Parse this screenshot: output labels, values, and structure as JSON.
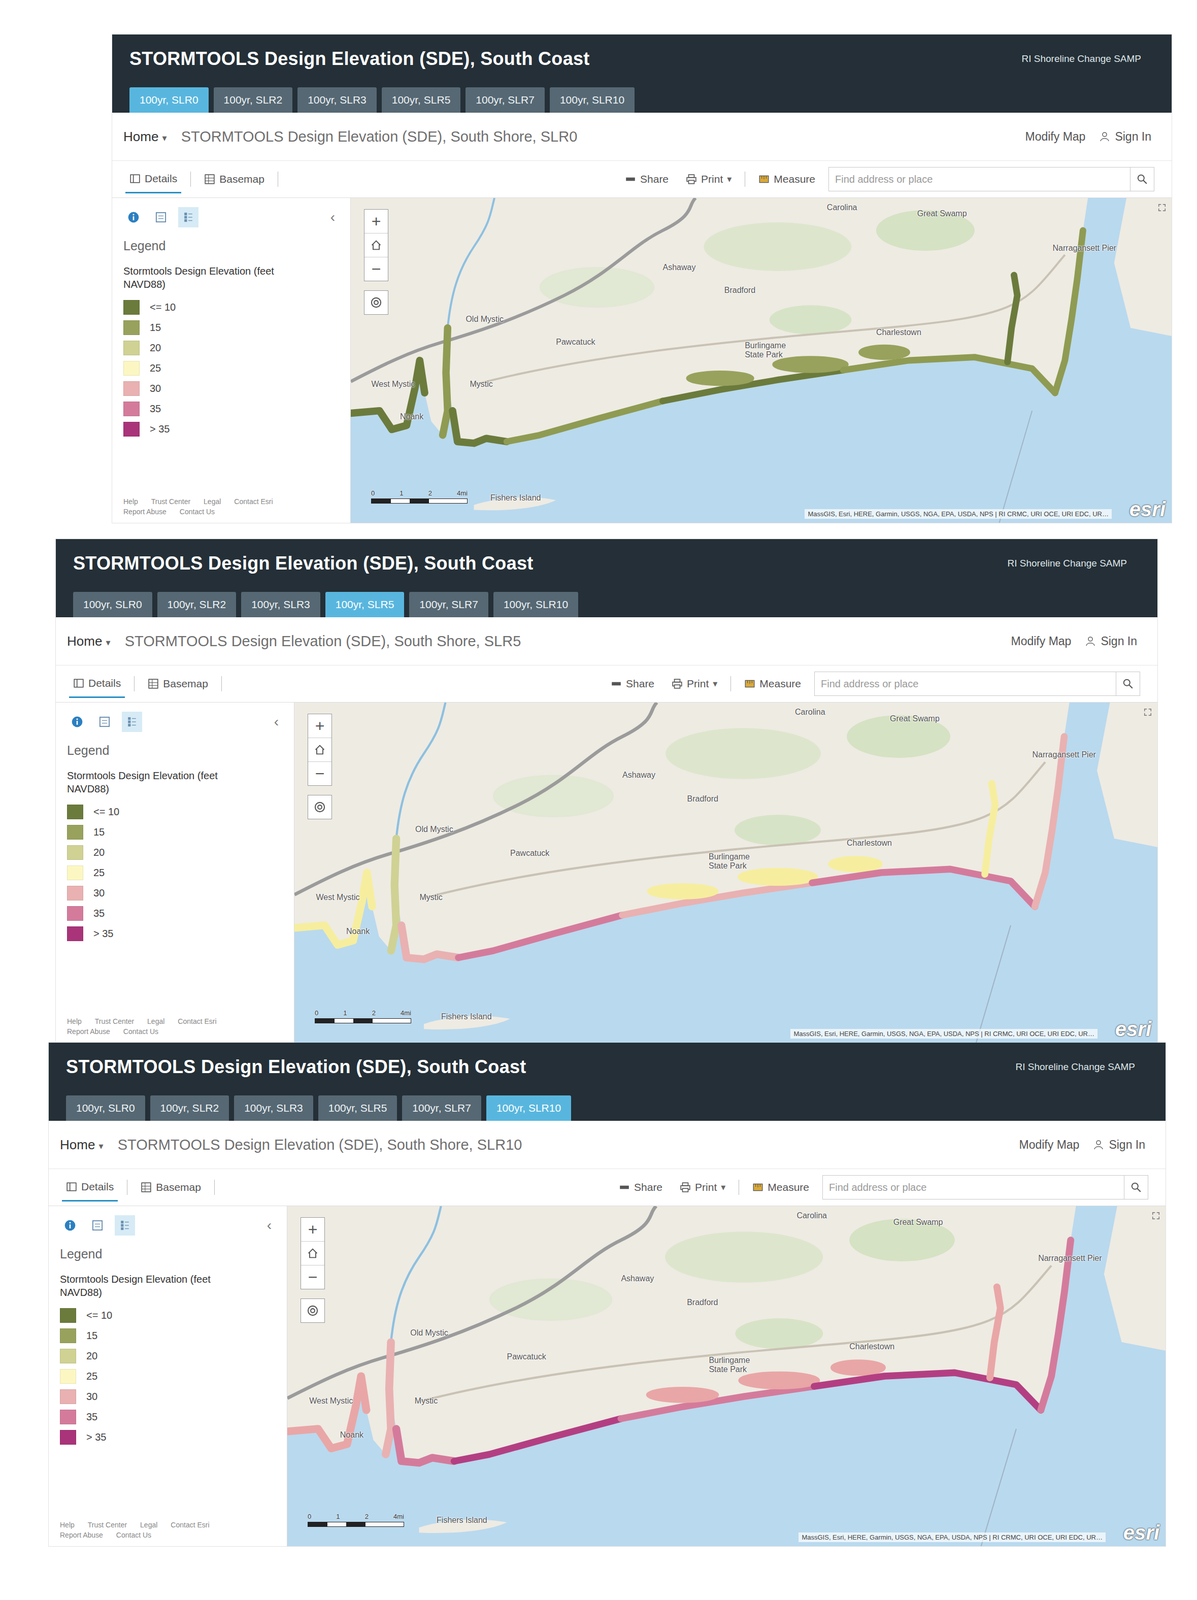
{
  "panels": [
    {
      "title": "STORMTOOLS Design Elevation (SDE), South Coast",
      "org": "RI Shoreline Change SAMP",
      "tabs": [
        {
          "label": "100yr, SLR0",
          "selected": true
        },
        {
          "label": "100yr, SLR2",
          "selected": false
        },
        {
          "label": "100yr, SLR3",
          "selected": false
        },
        {
          "label": "100yr, SLR5",
          "selected": false
        },
        {
          "label": "100yr, SLR7",
          "selected": false
        },
        {
          "label": "100yr, SLR10",
          "selected": false
        }
      ],
      "home": "Home",
      "home_arrow": "▾",
      "map_title": "STORMTOOLS Design Elevation (SDE), South Shore, SLR0",
      "modify_map": "Modify Map",
      "sign_in": "Sign In",
      "details": "Details",
      "basemap": "Basemap",
      "share": "Share",
      "print": "Print",
      "print_arrow": "▾",
      "measure": "Measure",
      "search_placeholder": "Find address or place",
      "collapse": "‹",
      "legend_title": "Legend",
      "legend_heading": "Stormtools Design Elevation (feet NAVD88)",
      "legend_classes": [
        {
          "label": "<= 10",
          "color": "#6b7b3c"
        },
        {
          "label": "15",
          "color": "#98a25c"
        },
        {
          "label": "20",
          "color": "#cfd293"
        },
        {
          "label": "25",
          "color": "#fcf7c2"
        },
        {
          "label": "30",
          "color": "#e9b1b1"
        },
        {
          "label": "35",
          "color": "#d47b9c"
        },
        {
          "label": "> 35",
          "color": "#a93479"
        }
      ],
      "footer_links": [
        "Help",
        "Trust Center",
        "Legal",
        "Contact Esri",
        "Report Abuse",
        "Contact Us"
      ],
      "zoom_in": "+",
      "zoom_out": "−",
      "place_labels": [
        "Carolina",
        "Great Swamp",
        "Ashaway",
        "Bradford",
        "Old Mystic",
        "Pawcatuck",
        "West Mystic",
        "Mystic",
        "Noank",
        "Burlingame State Park",
        "Charlestown",
        "Narragansett Pier",
        "Fishers Island"
      ],
      "scale_labels": [
        "0",
        "1",
        "2",
        "4mi"
      ],
      "attribution": "MassGIS, Esri, HERE, Garmin, USGS, NGA, EPA, USDA, NPS | RI CRMC, URI OCE, URI EDC, UR…",
      "logo": "esri",
      "flood_zones": [
        {
          "color": "#6b7b3c"
        },
        {
          "color": "#8f9b52"
        },
        {
          "color": "#6b7b3c"
        },
        {
          "color": "#8f9b52"
        },
        {
          "color": "#6b7b3c"
        },
        {
          "color": "#98a25c"
        },
        {
          "color": "#8f9b52"
        },
        {
          "color": "#6b7b3c"
        },
        {
          "color": "#8f9b52"
        }
      ]
    },
    {
      "title": "STORMTOOLS Design Elevation (SDE), South Coast",
      "org": "RI Shoreline Change SAMP",
      "tabs": [
        {
          "label": "100yr, SLR0",
          "selected": false
        },
        {
          "label": "100yr, SLR2",
          "selected": false
        },
        {
          "label": "100yr, SLR3",
          "selected": false
        },
        {
          "label": "100yr, SLR5",
          "selected": true
        },
        {
          "label": "100yr, SLR7",
          "selected": false
        },
        {
          "label": "100yr, SLR10",
          "selected": false
        }
      ],
      "home": "Home",
      "home_arrow": "▾",
      "map_title": "STORMTOOLS Design Elevation (SDE), South Shore, SLR5",
      "modify_map": "Modify Map",
      "sign_in": "Sign In",
      "details": "Details",
      "basemap": "Basemap",
      "share": "Share",
      "print": "Print",
      "print_arrow": "▾",
      "measure": "Measure",
      "search_placeholder": "Find address or place",
      "collapse": "‹",
      "legend_title": "Legend",
      "legend_heading": "Stormtools Design Elevation (feet NAVD88)",
      "legend_classes": [
        {
          "label": "<= 10",
          "color": "#6b7b3c"
        },
        {
          "label": "15",
          "color": "#98a25c"
        },
        {
          "label": "20",
          "color": "#cfd293"
        },
        {
          "label": "25",
          "color": "#fcf7c2"
        },
        {
          "label": "30",
          "color": "#e9b1b1"
        },
        {
          "label": "35",
          "color": "#d47b9c"
        },
        {
          "label": "> 35",
          "color": "#a93479"
        }
      ],
      "footer_links": [
        "Help",
        "Trust Center",
        "Legal",
        "Contact Esri",
        "Report Abuse",
        "Contact Us"
      ],
      "zoom_in": "+",
      "zoom_out": "−",
      "place_labels": [
        "Carolina",
        "Great Swamp",
        "Ashaway",
        "Bradford",
        "Old Mystic",
        "Pawcatuck",
        "West Mystic",
        "Mystic",
        "Noank",
        "Burlingame State Park",
        "Charlestown",
        "Narragansett Pier",
        "Fishers Island"
      ],
      "scale_labels": [
        "0",
        "1",
        "2",
        "4mi"
      ],
      "attribution": "MassGIS, Esri, HERE, Garmin, USGS, NGA, EPA, USDA, NPS | RI CRMC, URI OCE, URI EDC, UR…",
      "logo": "esri",
      "flood_zones": [
        {
          "color": "#f6ee9e"
        },
        {
          "color": "#cfd293"
        },
        {
          "color": "#e9b1b1"
        },
        {
          "color": "#d47b9c"
        },
        {
          "color": "#e9b1b1"
        },
        {
          "color": "#f6ee9e"
        },
        {
          "color": "#d47b9c"
        },
        {
          "color": "#f6ee9e"
        },
        {
          "color": "#e9b1b1"
        }
      ]
    },
    {
      "title": "STORMTOOLS Design Elevation (SDE), South Coast",
      "org": "RI Shoreline Change SAMP",
      "tabs": [
        {
          "label": "100yr, SLR0",
          "selected": false
        },
        {
          "label": "100yr, SLR2",
          "selected": false
        },
        {
          "label": "100yr, SLR3",
          "selected": false
        },
        {
          "label": "100yr, SLR5",
          "selected": false
        },
        {
          "label": "100yr, SLR7",
          "selected": false
        },
        {
          "label": "100yr, SLR10",
          "selected": true
        }
      ],
      "home": "Home",
      "home_arrow": "▾",
      "map_title": "STORMTOOLS Design Elevation (SDE), South Shore, SLR10",
      "modify_map": "Modify Map",
      "sign_in": "Sign In",
      "details": "Details",
      "basemap": "Basemap",
      "share": "Share",
      "print": "Print",
      "print_arrow": "▾",
      "measure": "Measure",
      "search_placeholder": "Find address or place",
      "collapse": "‹",
      "legend_title": "Legend",
      "legend_heading": "Stormtools Design Elevation (feet NAVD88)",
      "legend_classes": [
        {
          "label": "<= 10",
          "color": "#6b7b3c"
        },
        {
          "label": "15",
          "color": "#98a25c"
        },
        {
          "label": "20",
          "color": "#cfd293"
        },
        {
          "label": "25",
          "color": "#fcf7c2"
        },
        {
          "label": "30",
          "color": "#e9b1b1"
        },
        {
          "label": "35",
          "color": "#d47b9c"
        },
        {
          "label": "> 35",
          "color": "#a93479"
        }
      ],
      "footer_links": [
        "Help",
        "Trust Center",
        "Legal",
        "Contact Esri",
        "Report Abuse",
        "Contact Us"
      ],
      "zoom_in": "+",
      "zoom_out": "−",
      "place_labels": [
        "Carolina",
        "Great Swamp",
        "Ashaway",
        "Bradford",
        "Old Mystic",
        "Pawcatuck",
        "West Mystic",
        "Mystic",
        "Noank",
        "Burlingame State Park",
        "Charlestown",
        "Narragansett Pier",
        "Fishers Island"
      ],
      "scale_labels": [
        "0",
        "1",
        "2",
        "4mi"
      ],
      "attribution": "MassGIS, Esri, HERE, Garmin, USGS, NGA, EPA, USDA, NPS | RI CRMC, URI OCE, URI EDC, UR…",
      "logo": "esri",
      "flood_zones": [
        {
          "color": "#e9a6a6"
        },
        {
          "color": "#e9b1b1"
        },
        {
          "color": "#d47b9c"
        },
        {
          "color": "#b33f82"
        },
        {
          "color": "#d47b9c"
        },
        {
          "color": "#e9a6a6"
        },
        {
          "color": "#b33f82"
        },
        {
          "color": "#e9a6a6"
        },
        {
          "color": "#d47b9c"
        }
      ]
    }
  ]
}
